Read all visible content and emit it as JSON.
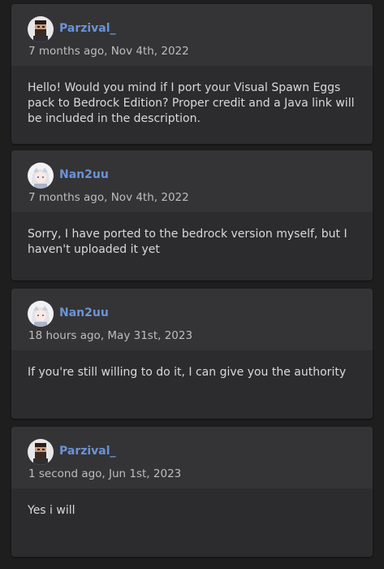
{
  "colors": {
    "page_background": "#1e1e1f",
    "card_background": "#2c2c2e",
    "card_header_background": "#343436",
    "username": "#6b93d6",
    "timestamp": "#bdbdbd",
    "body_text": "#d9d9d9"
  },
  "comments": [
    {
      "avatar_icon": "bearded-man-avatar-icon",
      "username": "Parzival_",
      "timestamp": "7 months ago, Nov 4th, 2022",
      "text": "Hello! Would you mind if I port your Visual Spawn Eggs pack to Bedrock Edition? Proper credit and a Java link will be included in the description."
    },
    {
      "avatar_icon": "anime-girl-avatar-icon",
      "username": "Nan2uu",
      "timestamp": "7 months ago, Nov 4th, 2022",
      "text": "Sorry, I have ported to the bedrock version myself, but I haven't uploaded it yet"
    },
    {
      "avatar_icon": "anime-girl-avatar-icon",
      "username": "Nan2uu",
      "timestamp": "18 hours ago, May 31st, 2023",
      "text": "If you're still willing to do it, I can give you the authority"
    },
    {
      "avatar_icon": "bearded-man-avatar-icon",
      "username": "Parzival_",
      "timestamp": "1 second ago, Jun 1st, 2023",
      "text": "Yes i will"
    }
  ]
}
